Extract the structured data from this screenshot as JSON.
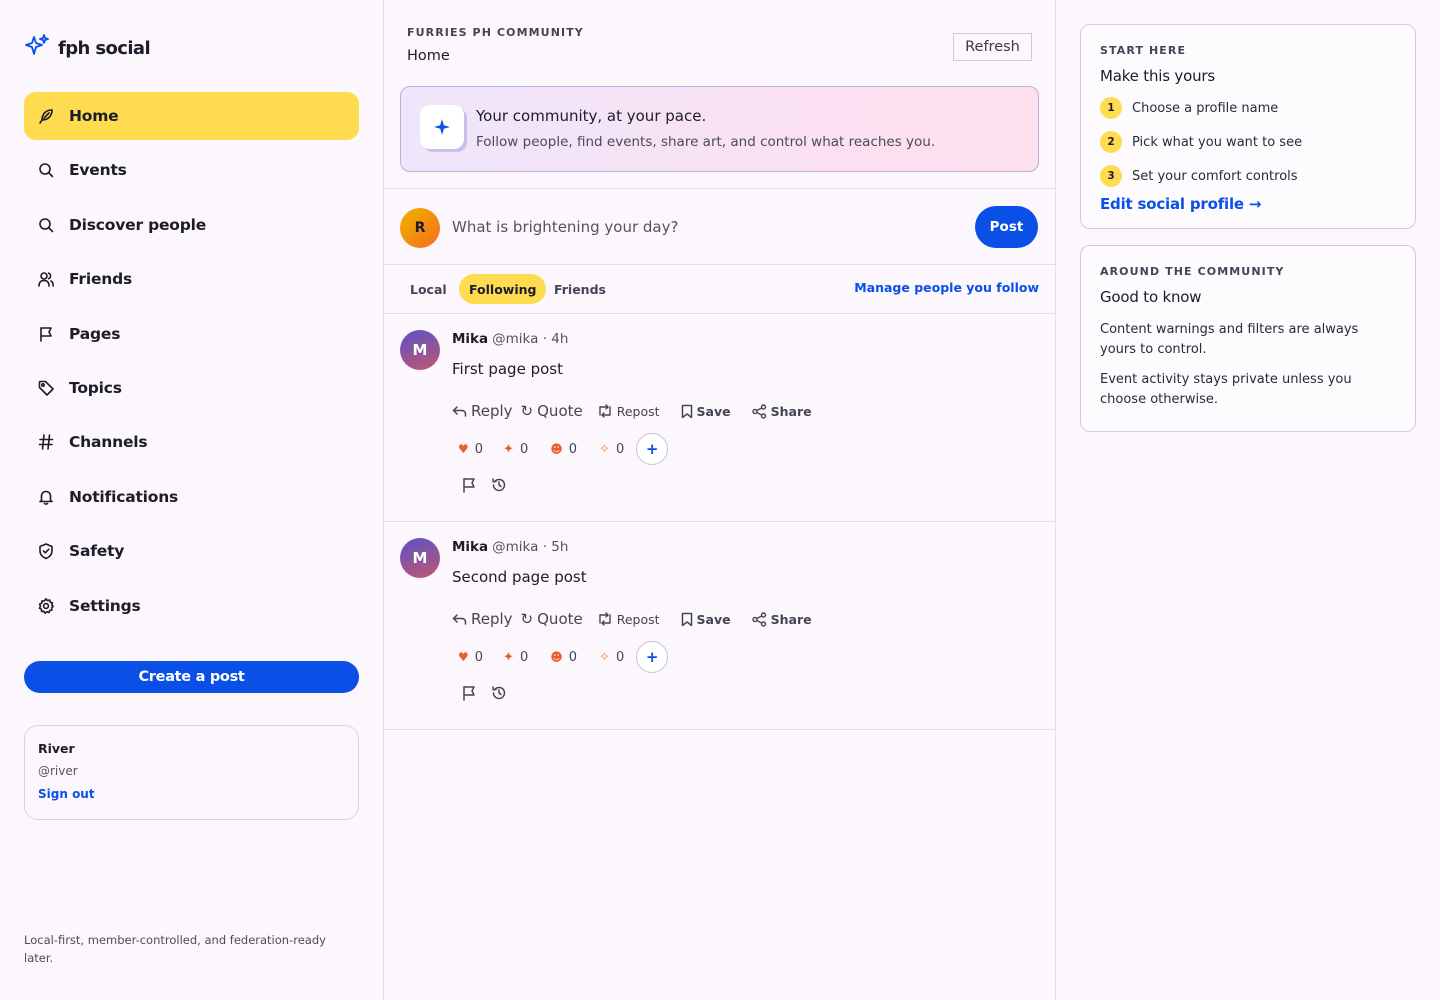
{
  "brand": {
    "name": "fph social"
  },
  "sidebar": {
    "items": [
      {
        "label": "Home",
        "icon": "feather-icon",
        "active": true
      },
      {
        "label": "Events",
        "icon": "search-icon"
      },
      {
        "label": "Discover people",
        "icon": "search-icon"
      },
      {
        "label": "Friends",
        "icon": "users-icon"
      },
      {
        "label": "Pages",
        "icon": "flag-icon"
      },
      {
        "label": "Topics",
        "icon": "tag-icon"
      },
      {
        "label": "Channels",
        "icon": "hash-icon"
      },
      {
        "label": "Notifications",
        "icon": "bell-icon"
      },
      {
        "label": "Safety",
        "icon": "shield-icon"
      },
      {
        "label": "Settings",
        "icon": "gear-icon"
      }
    ],
    "create_label": "Create a post",
    "user": {
      "name": "River",
      "handle": "@river",
      "signout": "Sign out"
    },
    "footer": "Local-first, member-controlled, and federation-ready later."
  },
  "main": {
    "eyebrow": "FURRIES PH COMMUNITY",
    "title": "Home",
    "refresh_label": "Refresh",
    "banner": {
      "title": "Your community, at your pace.",
      "subtitle": "Follow people, find events, share art, and control what reaches you."
    },
    "composer": {
      "avatar_initial": "R",
      "placeholder": "What is brightening your day?",
      "post_label": "Post"
    },
    "tabs": [
      {
        "label": "Local",
        "active": false
      },
      {
        "label": "Following",
        "active": true
      },
      {
        "label": "Friends",
        "active": false
      }
    ],
    "manage_label": "Manage people you follow",
    "posts": [
      {
        "avatar_initial": "M",
        "author": "Mika",
        "meta": "@mika · 4h",
        "body": "First page post",
        "actions": {
          "reply": "Reply",
          "quote": "Quote",
          "repost": "Repost",
          "save": "Save",
          "share": "Share"
        },
        "reactions": [
          "0",
          "0",
          "0",
          "0"
        ]
      },
      {
        "avatar_initial": "M",
        "author": "Mika",
        "meta": "@mika · 5h",
        "body": "Second page post",
        "actions": {
          "reply": "Reply",
          "quote": "Quote",
          "repost": "Repost",
          "save": "Save",
          "share": "Share"
        },
        "reactions": [
          "0",
          "0",
          "0",
          "0"
        ]
      }
    ]
  },
  "right": {
    "start": {
      "eyebrow": "START HERE",
      "title": "Make this yours",
      "steps": [
        {
          "num": "1",
          "label": "Choose a profile name"
        },
        {
          "num": "2",
          "label": "Pick what you want to see"
        },
        {
          "num": "3",
          "label": "Set your comfort controls"
        }
      ],
      "link": "Edit social profile →"
    },
    "around": {
      "eyebrow": "AROUND THE COMMUNITY",
      "title": "Good to know",
      "p1": "Content warnings and filters are always yours to control.",
      "p2": "Event activity stays private unless you choose otherwise."
    }
  },
  "colors": {
    "accent": "#0a50e6",
    "highlight": "#ffdc4f",
    "background": "#fbf7fd"
  }
}
